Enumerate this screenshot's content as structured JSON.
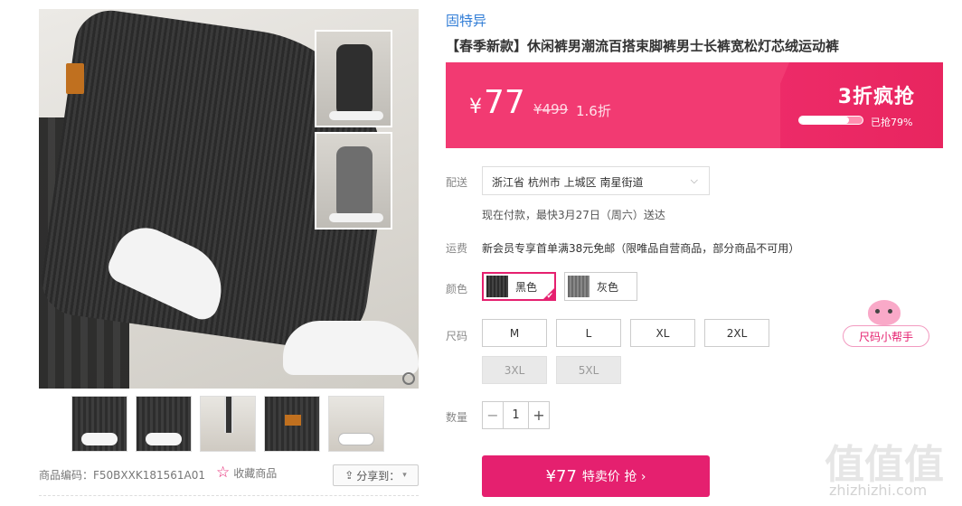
{
  "gallery": {
    "main_image_alt": "product-main-photo",
    "thumbnail_count": 5,
    "product_code": "商品编码：F50BXXK181561A01",
    "favorite_label": "收藏商品",
    "share_label": "分享到："
  },
  "product": {
    "brand": "固特异",
    "title": "【春季新款】休闲裤男潮流百搭束脚裤男士长裤宽松灯芯绒运动裤"
  },
  "price": {
    "currency": "¥",
    "current": "77",
    "original": "¥499",
    "discount": "1.6折",
    "flash_label": "3折疯抢",
    "sold_percent": 79,
    "sold_label": "已抢79%"
  },
  "delivery": {
    "label": "配送",
    "address": "浙江省 杭州市 上城区 南星街道",
    "eta": "现在付款，最快3月27日（周六）送达"
  },
  "freight": {
    "label": "运费",
    "text": "新会员专享首单满38元免邮（限唯品自营商品，部分商品不可用）"
  },
  "color": {
    "label": "颜色",
    "options": [
      {
        "name": "黑色",
        "selected": true
      },
      {
        "name": "灰色",
        "selected": false
      }
    ]
  },
  "size": {
    "label": "尺码",
    "options": [
      {
        "name": "M",
        "available": true
      },
      {
        "name": "L",
        "available": true
      },
      {
        "name": "XL",
        "available": true
      },
      {
        "name": "2XL",
        "available": true
      },
      {
        "name": "3XL",
        "available": false
      },
      {
        "name": "5XL",
        "available": false
      }
    ],
    "helper": "尺码小帮手"
  },
  "quantity": {
    "label": "数量",
    "value": "1",
    "minus": "−",
    "plus": "+"
  },
  "buy": {
    "price": "¥77",
    "label": "特卖价 抢 ›"
  },
  "watermark": {
    "text": "值值值",
    "url": "zhizhizhi.com"
  },
  "colors": {
    "accent": "#e5206f",
    "brand_link": "#2f7cd6"
  }
}
